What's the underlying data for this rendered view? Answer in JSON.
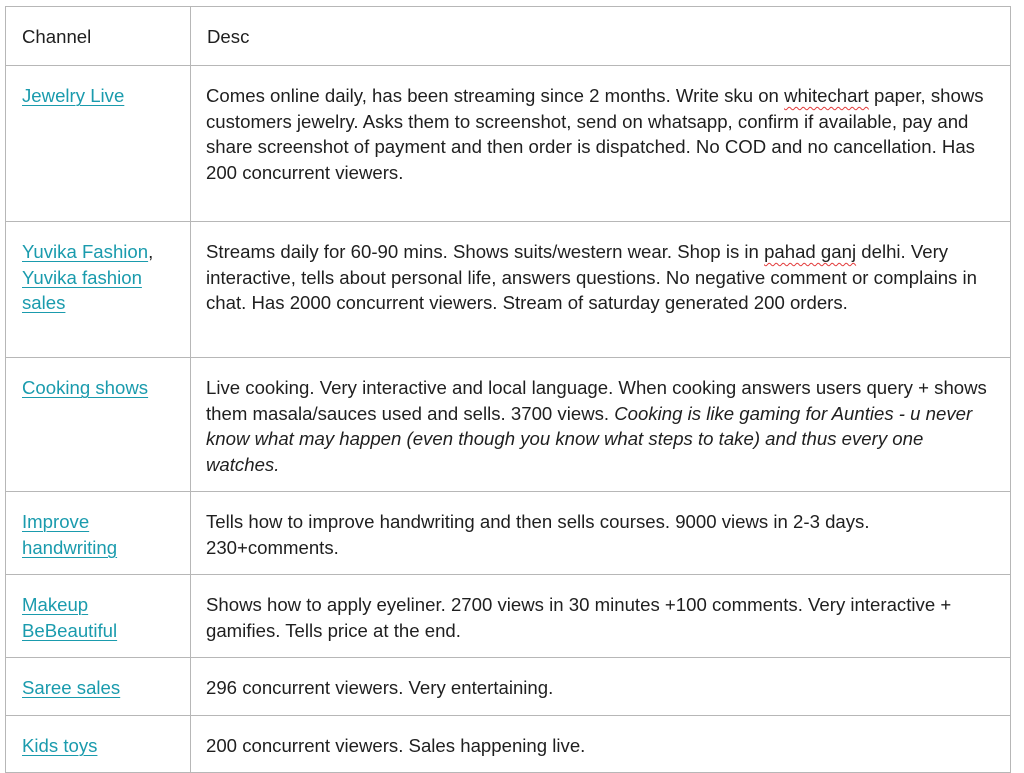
{
  "table": {
    "headers": {
      "channel": "Channel",
      "desc": "Desc"
    },
    "rows": [
      {
        "channel_links": [
          "Jewelry Live"
        ],
        "desc_parts": [
          {
            "text": "Comes online daily, has been streaming since 2 months. Write sku on ",
            "style": "normal"
          },
          {
            "text": "whitechart",
            "style": "spell"
          },
          {
            "text": " paper, shows customers jewelry. Asks them to screenshot, send on whatsapp, confirm if available, pay and share screenshot of payment and then order is dispatched. No COD and no cancellation. Has 200 concurrent viewers.",
            "style": "normal"
          }
        ]
      },
      {
        "channel_links": [
          "Yuvika Fashion",
          "Yuvika fashion sales"
        ],
        "channel_separator": ",",
        "desc_parts": [
          {
            "text": "Streams daily for 60-90 mins. Shows suits/western wear. Shop is in ",
            "style": "normal"
          },
          {
            "text": "pahad ganj",
            "style": "spell"
          },
          {
            "text": " delhi. Very interactive, tells about personal life, answers questions. No negative comment or complains in chat. Has 2000 concurrent viewers. Stream of saturday generated 200 orders.",
            "style": "normal"
          }
        ]
      },
      {
        "channel_links": [
          "Cooking shows"
        ],
        "desc_parts": [
          {
            "text": "Live cooking. Very interactive and local language. When cooking answers users query + shows them masala/sauces used and sells. 3700 views. ",
            "style": "normal"
          },
          {
            "text": "Cooking is like gaming for Aunties - u never know what may happen (even though you know what steps to take) and thus every one watches.",
            "style": "italic"
          }
        ]
      },
      {
        "channel_links": [
          "Improve handwriting"
        ],
        "desc_parts": [
          {
            "text": "Tells how to improve handwriting and then sells courses. 9000 views in 2-3 days. 230+comments.",
            "style": "normal"
          }
        ]
      },
      {
        "channel_links": [
          "Makeup BeBeautiful"
        ],
        "desc_parts": [
          {
            "text": "Shows how to apply eyeliner. 2700 views in 30 minutes +100 comments. Very interactive + gamifies. Tells price at the end.",
            "style": "normal"
          }
        ]
      },
      {
        "channel_links": [
          "Saree sales"
        ],
        "desc_parts": [
          {
            "text": "296 concurrent viewers. Very entertaining.",
            "style": "normal"
          }
        ]
      },
      {
        "channel_links": [
          "Kids toys"
        ],
        "desc_parts": [
          {
            "text": "200 concurrent viewers. Sales happening live.",
            "style": "normal"
          }
        ]
      }
    ]
  },
  "colors": {
    "link": "#1a9bad",
    "border": "#b7b7b7",
    "text": "#1f1f1f",
    "spellcheck": "#e23a3a"
  }
}
